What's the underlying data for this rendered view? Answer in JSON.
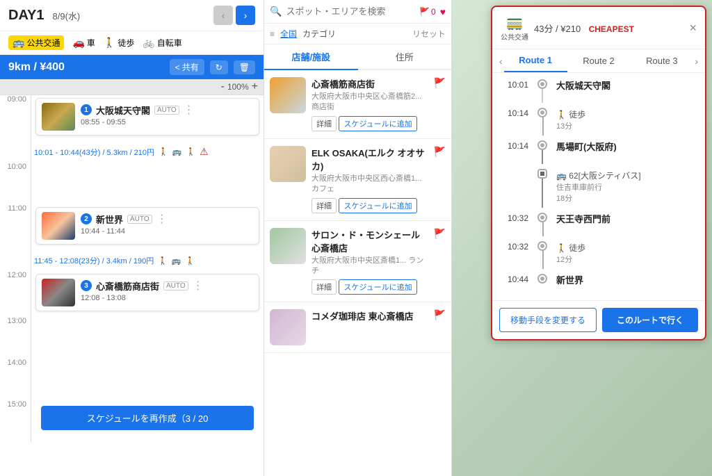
{
  "left": {
    "day": "DAY1",
    "date": "8/9(水)",
    "transport_modes": [
      {
        "label": "公共交通",
        "icon": "🚌",
        "active": true
      },
      {
        "label": "車",
        "icon": "🚗",
        "active": false
      },
      {
        "label": "徒歩",
        "icon": "🚶",
        "active": false
      },
      {
        "label": "自転車",
        "icon": "🚲",
        "active": false
      }
    ],
    "route_distance": "9km / ¥400",
    "share_label": "共有",
    "zoom_level": "100%",
    "zoom_minus": "-",
    "zoom_plus": "+",
    "schedule": [
      {
        "time_label": "09:00",
        "name": "大阪城天守閣",
        "time_range": "08:55 - 09:55",
        "badge_num": "1",
        "badge_auto": "AUTO",
        "thumb_class": "schedule-thumb-osaka"
      }
    ],
    "transit_1": {
      "text": "10:01 - 10:44(43分) / 5.3km / 210円",
      "icons": [
        "🚶",
        "🚌",
        "🚶"
      ],
      "alert": "⚠"
    },
    "schedule_2": [
      {
        "time_label": "11:00",
        "name": "新世界",
        "time_range": "10:44 - 11:44",
        "badge_num": "2",
        "badge_auto": "AUTO",
        "thumb_class": "schedule-thumb-shinsekai"
      }
    ],
    "transit_2": {
      "text": "11:45 - 12:08(23分) / 3.4km / 190円",
      "icons": [
        "🚶",
        "🚌",
        "🚶"
      ]
    },
    "schedule_3": [
      {
        "time_label": "12:00",
        "name": "心斎橋筋商店街",
        "time_range": "12:08 - 13:08",
        "badge_num": "3",
        "badge_auto": "AUTO",
        "thumb_class": "schedule-thumb-shinsaibashi"
      }
    ],
    "time_labels": [
      "09:00",
      "10:00",
      "11:00",
      "12:00",
      "13:00",
      "14:00",
      "15:00"
    ],
    "reschedule_label": "スケジュールを再作成（3 / 20"
  },
  "middle": {
    "search_placeholder": "スポット・エリアを検索",
    "flag_count": "0",
    "filter_label": "全国",
    "category_label": "カテゴリ",
    "reset_label": "リセット",
    "tab_shops": "店舗/施設",
    "tab_address": "住所",
    "places": [
      {
        "name": "心斎橋筋商店街",
        "addr": "大阪府大阪市中央区心斎橋筋2... 商店街",
        "category": "",
        "thumb_class": "place-thumb-1"
      },
      {
        "name": "ELK OSAKA(エルク オオサカ)",
        "addr": "大阪府大阪市中央区西心斎橋1... カフェ",
        "category": "",
        "thumb_class": "place-thumb-2"
      },
      {
        "name": "サロン・ド・モンシェール 心斎橋店",
        "addr": "大阪府大阪市中央区斎橋1... ランチ",
        "category": "",
        "thumb_class": "place-thumb-3"
      },
      {
        "name": "コメダ珈琲店 東心斎橋店",
        "addr": "",
        "category": "",
        "thumb_class": "place-thumb-4"
      }
    ],
    "detail_label": "詳細",
    "add_label": "スケジュールに追加"
  },
  "route_panel": {
    "transport_icon": "🚃",
    "summary": "43分 / ¥210",
    "cheapest": "CHEAPEST",
    "close": "×",
    "transport_label": "公共交通",
    "tabs": [
      "Route 1",
      "Route 2",
      "Route 3"
    ],
    "active_tab": 0,
    "steps": [
      {
        "time": "10:01",
        "place": "大阪城天守閣",
        "type": "station",
        "detail": "",
        "sub": ""
      },
      {
        "time": "10:14",
        "place": "",
        "type": "walk",
        "detail": "徒歩",
        "sub": "13分"
      },
      {
        "time": "10:14",
        "place": "馬場町(大阪府)",
        "type": "station",
        "detail": "",
        "sub": ""
      },
      {
        "time": "",
        "place": "",
        "type": "bus",
        "detail": "62[大阪シティバス]",
        "sub": "住吉車庫前行\n18分"
      },
      {
        "time": "10:32",
        "place": "天王寺西門前",
        "type": "station",
        "detail": "",
        "sub": ""
      },
      {
        "time": "10:32",
        "place": "",
        "type": "walk",
        "detail": "徒歩",
        "sub": "12分"
      },
      {
        "time": "10:44",
        "place": "新世界",
        "type": "station",
        "detail": "",
        "sub": ""
      }
    ],
    "change_btn": "移動手段を変更する",
    "go_btn": "このルートで行く"
  }
}
